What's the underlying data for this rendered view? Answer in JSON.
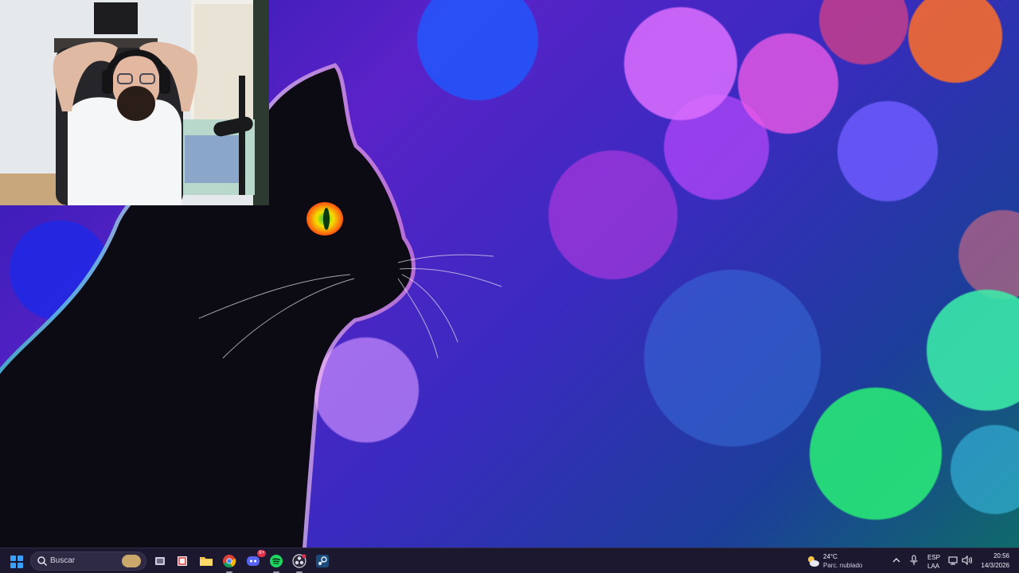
{
  "taskbar": {
    "search": {
      "placeholder": "Buscar",
      "icon": "search-icon"
    },
    "apps": [
      {
        "name": "task-view",
        "icon": "task-view-icon"
      },
      {
        "name": "snipping-tool",
        "icon": "snipping-tool-icon"
      },
      {
        "name": "file-explorer",
        "icon": "folder-icon"
      },
      {
        "name": "chrome",
        "icon": "chrome-icon",
        "active": true
      },
      {
        "name": "discord",
        "icon": "discord-icon",
        "badge": "9+"
      },
      {
        "name": "spotify",
        "icon": "spotify-icon",
        "active": true
      },
      {
        "name": "obs",
        "icon": "obs-icon",
        "active": true
      },
      {
        "name": "steam",
        "icon": "steam-icon"
      }
    ],
    "weather": {
      "temp": "24°C",
      "description": "Parc. nublado",
      "icon": "partly-cloudy-icon"
    },
    "language": {
      "line1": "ESP",
      "line2": "LAA"
    },
    "clock": {
      "time": "20:56",
      "date": "14/3/2026"
    }
  },
  "colors": {
    "taskbar_bg": "#1c1830",
    "accent": "#3aa0ff"
  }
}
